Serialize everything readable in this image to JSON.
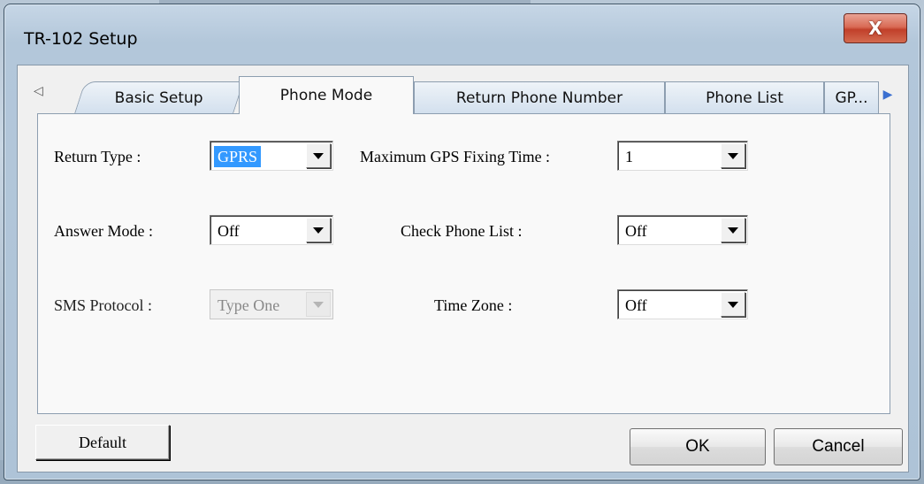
{
  "window": {
    "title": "TR-102 Setup",
    "close_glyph": "X"
  },
  "tabs": {
    "scroll_left_icon": "◁",
    "scroll_right_icon": "▶",
    "items": [
      {
        "label": "Basic Setup"
      },
      {
        "label": "Phone Mode"
      },
      {
        "label": "Return Phone Number"
      },
      {
        "label": "Phone List"
      },
      {
        "label": "GP..."
      }
    ],
    "active_index": 1
  },
  "form": {
    "return_type": {
      "label": "Return Type :",
      "value": "GPRS"
    },
    "answer_mode": {
      "label": "Answer Mode :",
      "value": "Off"
    },
    "sms_protocol": {
      "label": "SMS Protocol :",
      "value": "Type One",
      "disabled": true
    },
    "max_gps_fixing_time": {
      "label": "Maximum GPS Fixing Time :",
      "value": "1"
    },
    "check_phone_list": {
      "label": "Check Phone List :",
      "value": "Off"
    },
    "time_zone": {
      "label": "Time Zone :",
      "value": "Off"
    }
  },
  "buttons": {
    "default_label": "Default",
    "ok_label": "OK",
    "cancel_label": "Cancel"
  },
  "colors": {
    "selection": "#3399ff",
    "close_button": "#c1402a",
    "panel": "#f9f9f9"
  }
}
